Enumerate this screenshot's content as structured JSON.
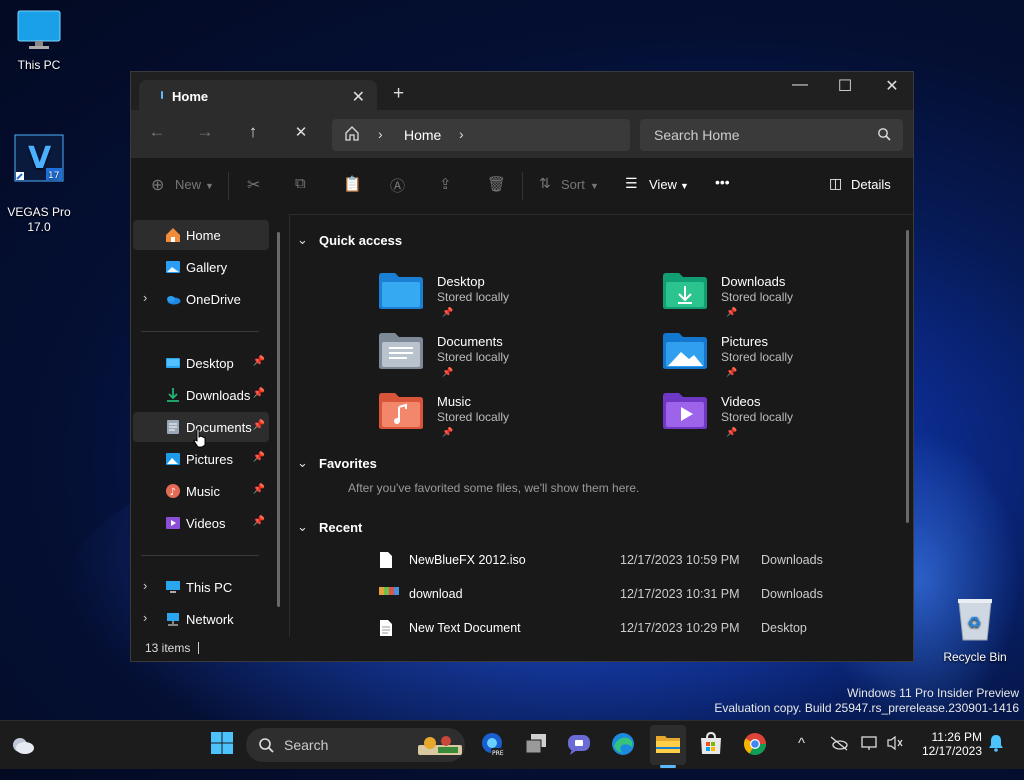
{
  "desktop": {
    "icons": [
      {
        "label": "This PC",
        "icon": "monitor-icon"
      },
      {
        "label": "VEGAS Pro\n17.0",
        "icon": "vegas-pro-icon"
      },
      {
        "label": "Recycle Bin",
        "icon": "recycle-bin-icon"
      }
    ],
    "watermark_line1": "Windows 11 Pro Insider Preview",
    "watermark_line2": "Evaluation copy. Build 25947.rs_prerelease.230901-1416"
  },
  "explorer": {
    "tab_title": "Home",
    "new_tab": "+",
    "window_controls": {
      "minimize": "—",
      "maximize": "☐",
      "close": "✕"
    },
    "nav": {
      "back": "←",
      "forward": "→",
      "up": "↑",
      "stop": "✕"
    },
    "address": {
      "crumb": "Home"
    },
    "search": {
      "placeholder": "Search Home"
    },
    "toolbar": {
      "new": "New",
      "sort": "Sort",
      "view": "View",
      "more": "•••",
      "details": "Details"
    },
    "sidebar": {
      "items": [
        {
          "label": "Home"
        },
        {
          "label": "Gallery"
        },
        {
          "label": "OneDrive"
        },
        {
          "label": "Desktop"
        },
        {
          "label": "Downloads"
        },
        {
          "label": "Documents"
        },
        {
          "label": "Pictures"
        },
        {
          "label": "Music"
        },
        {
          "label": "Videos"
        },
        {
          "label": "This PC"
        },
        {
          "label": "Network"
        }
      ]
    },
    "sections": {
      "quick_access": "Quick access",
      "favorites": "Favorites",
      "recent": "Recent"
    },
    "quick_access": [
      {
        "name": "Desktop",
        "sub": "Stored locally"
      },
      {
        "name": "Downloads",
        "sub": "Stored locally"
      },
      {
        "name": "Documents",
        "sub": "Stored locally"
      },
      {
        "name": "Pictures",
        "sub": "Stored locally"
      },
      {
        "name": "Music",
        "sub": "Stored locally"
      },
      {
        "name": "Videos",
        "sub": "Stored locally"
      }
    ],
    "favorites_empty": "After you've favorited some files, we'll show them here.",
    "recent": [
      {
        "name": "NewBlueFX 2012.iso",
        "date": "12/17/2023 10:59 PM",
        "location": "Downloads"
      },
      {
        "name": "download",
        "date": "12/17/2023 10:31 PM",
        "location": "Downloads"
      },
      {
        "name": "New Text Document",
        "date": "12/17/2023 10:29 PM",
        "location": "Desktop"
      }
    ],
    "status": "13 items"
  },
  "taskbar": {
    "search": "Search",
    "time": "11:26 PM",
    "date": "12/17/2023"
  },
  "colors": {
    "accent": "#5cb8ff",
    "window_bg": "#191919",
    "toolbar_bg": "#2c2c2c"
  }
}
